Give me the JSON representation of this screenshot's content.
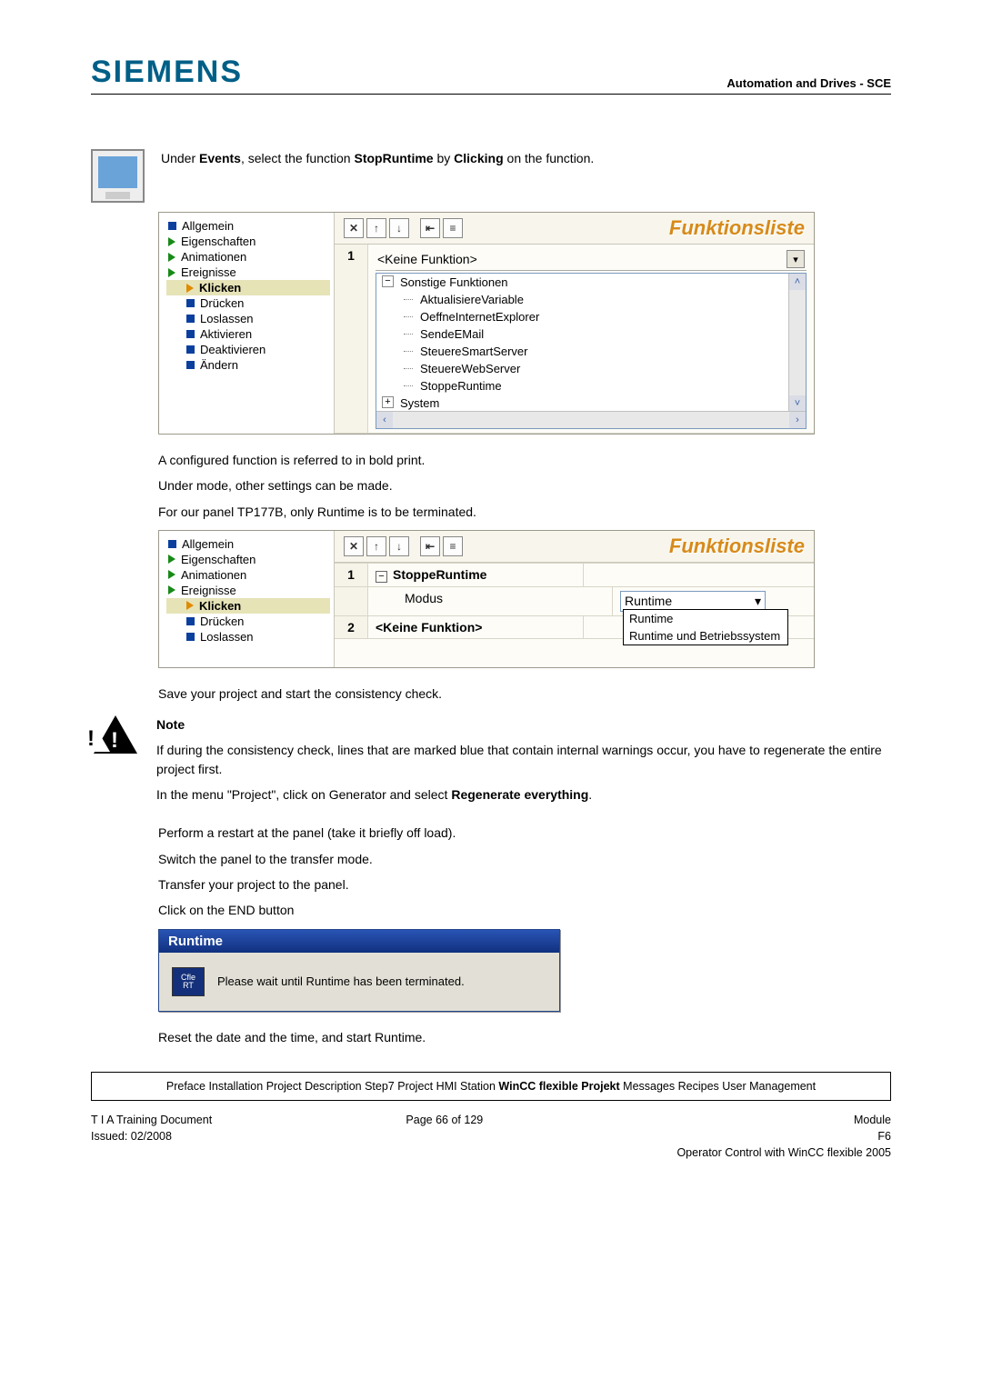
{
  "header": {
    "logo": "SIEMENS",
    "right": "Automation and Drives - SCE"
  },
  "intro": {
    "line1_a": "Under ",
    "line1_b": "Events",
    "line1_c": ", select the function ",
    "line1_d": "StopRuntime",
    "line1_e": " by ",
    "line1_f": "Clicking",
    "line1_g": " on the function."
  },
  "sshot1": {
    "title": "Funktionsliste",
    "tree": {
      "allgemein": "Allgemein",
      "eigenschaften": "Eigenschaften",
      "animationen": "Animationen",
      "ereignisse": "Ereignisse",
      "klicken": "Klicken",
      "druecken": "Drücken",
      "loslassen": "Loslassen",
      "aktivieren": "Aktivieren",
      "deaktivieren": "Deaktivieren",
      "aendern": "Ändern"
    },
    "row1_num": "1",
    "row1_label": "<Keine Funktion>",
    "list": {
      "sonstige": "Sonstige Funktionen",
      "aktualisiere": "AktualisiereVariable",
      "oeffne": "OeffneInternetExplorer",
      "sendemail": "SendeEMail",
      "smart": "SteuereSmartServer",
      "web": "SteuereWebServer",
      "stoppe": "StoppeRuntime",
      "system": "System"
    }
  },
  "mid": {
    "p1": "A configured function is referred to in bold print.",
    "p2": "Under mode, other settings can be made.",
    "p3": "For our panel TP177B, only Runtime is to be terminated."
  },
  "sshot2": {
    "title": "Funktionsliste",
    "tree": {
      "allgemein": "Allgemein",
      "eigenschaften": "Eigenschaften",
      "animationen": "Animationen",
      "ereignisse": "Ereignisse",
      "klicken": "Klicken",
      "druecken": "Drücken",
      "loslassen": "Loslassen"
    },
    "r1_num": "1",
    "r1_label": "StoppeRuntime",
    "r1_modus": "Modus",
    "r1_val": "Runtime",
    "r2_num": "2",
    "r2_label": "<Keine Funktion>",
    "dd_opt1": "Runtime",
    "dd_opt2": "Runtime und Betriebssystem"
  },
  "save_line": "Save your project and start the consistency check.",
  "note": {
    "heading": "Note",
    "p1": "If during the consistency check, lines that are marked blue that contain internal warnings occur, you have to regenerate the entire project first.",
    "p2a": "In the menu \"Project\", click on Generator and select ",
    "p2b": "Regenerate everything",
    "p2c": "."
  },
  "steps": {
    "s1": "Perform a restart at the panel (take it briefly off load).",
    "s2": "Switch the panel to the transfer mode.",
    "s3": "Transfer your project to the panel.",
    "s4": "Click on the END button"
  },
  "runtime_dialog": {
    "title": "Runtime",
    "icon_l1": "Cfle",
    "icon_l2": "RT",
    "body": "Please wait until Runtime has been terminated."
  },
  "reset_line": "Reset the date and the time, and start Runtime.",
  "nav": {
    "preface": "Preface",
    "installation": "Installation",
    "projdesc": "Project Description",
    "step7": "Step7 Project",
    "hmi": "HMI Station",
    "wincc": "WinCC flexible Projekt",
    "messages": "Messages",
    "recipes": "Recipes",
    "usermgmt": "User Management"
  },
  "footer": {
    "l1": "T I A  Training Document",
    "l2": "Issued: 02/2008",
    "c1": "Page 66 of 129",
    "r1": "Module",
    "r2": "F6",
    "r3": "Operator Control with WinCC flexible 2005"
  }
}
